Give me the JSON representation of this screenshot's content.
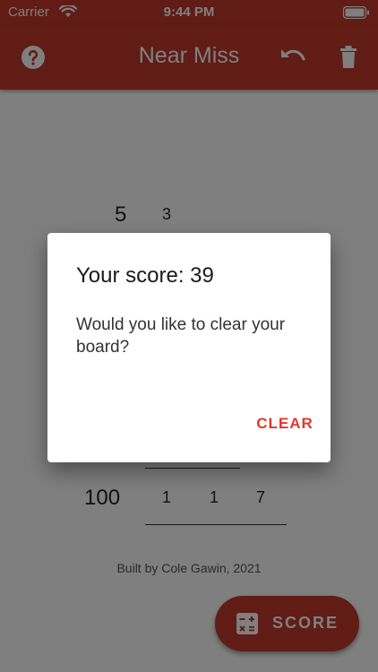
{
  "status_bar": {
    "carrier": "Carrier",
    "time": "9:44 PM",
    "icons": [
      "wifi-icon",
      "battery-icon"
    ]
  },
  "app_bar": {
    "title": "Near Miss",
    "icons": [
      "help-icon",
      "undo-icon",
      "trash-icon"
    ],
    "color": "#c0392b"
  },
  "board": {
    "top_numbers": [
      "5",
      "3"
    ],
    "bottom_row": {
      "total": "100",
      "digits": [
        "1",
        "1",
        "7"
      ]
    }
  },
  "footer": {
    "credit": "Built by Cole Gawin, 2021"
  },
  "fab": {
    "label": "SCORE",
    "icon": "calculator-icon"
  },
  "dialog": {
    "title": "Your score: 39",
    "message": "Would you like to clear your board?",
    "action_label": "CLEAR",
    "action_color": "#e0392b"
  }
}
